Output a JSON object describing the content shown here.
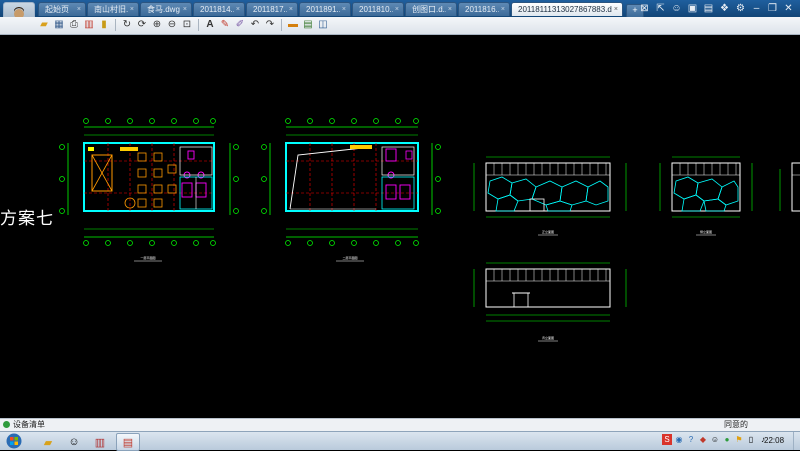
{
  "tabs": [
    {
      "label": "起始页",
      "active": false
    },
    {
      "label": "南山村旧...",
      "active": false
    },
    {
      "label": "食马.dwg",
      "active": false
    },
    {
      "label": "2011814...",
      "active": false
    },
    {
      "label": "2011817...",
      "active": false
    },
    {
      "label": "2011891...",
      "active": false
    },
    {
      "label": "2011810...",
      "active": false
    },
    {
      "label": "创图口.d...",
      "active": false
    },
    {
      "label": "2011816...",
      "active": false
    },
    {
      "label": "20118111313027867883.d...",
      "active": true
    }
  ],
  "title_icons": [
    "pin-icon",
    "share-icon",
    "users-icon",
    "message-icon",
    "image-icon",
    "skin-icon",
    "settings-icon",
    "minimize-icon",
    "restore-icon",
    "close-icon"
  ],
  "toolbar_icons": [
    "open-icon",
    "save-icon",
    "print-icon",
    "export-pdf-icon",
    "lock-icon",
    "rotate-icon",
    "refresh-icon",
    "zoom-in-icon",
    "zoom-out-icon",
    "zoom-window-icon",
    "text-icon",
    "pen-icon",
    "brush-icon",
    "undo-icon",
    "redo-icon",
    "measure-icon",
    "layer-icon",
    "layers-icon"
  ],
  "drawing": {
    "side_label": "方案七",
    "plan1_caption": "一层平面图",
    "plan2_caption": "二层平面图",
    "elev1_caption": "正立面图",
    "elev2_caption": "侧立面图",
    "elev3_caption": "背立面图"
  },
  "status": {
    "left_label": "设备清单",
    "zoom_label": "同意的"
  },
  "taskbar": {
    "clock": "22:08"
  },
  "colors": {
    "accent": "#1f5f9e",
    "cad_green": "#00ff00",
    "cad_cyan": "#00ffff",
    "cad_red": "#ff0000",
    "cad_orange": "#ff9900",
    "cad_magenta": "#ff00ff"
  }
}
